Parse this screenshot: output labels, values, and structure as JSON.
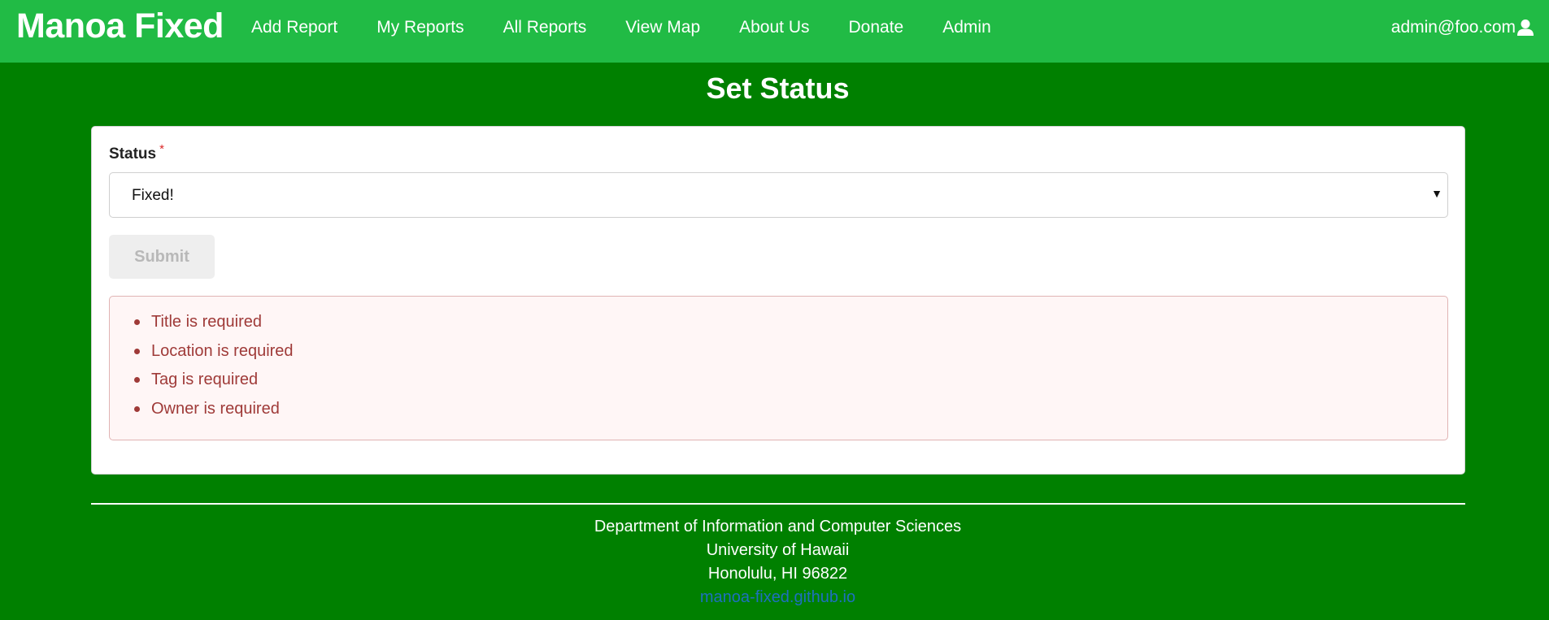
{
  "navbar": {
    "brand": "Manoa Fixed",
    "links": [
      "Add Report",
      "My Reports",
      "All Reports",
      "View Map",
      "About Us",
      "Donate",
      "Admin"
    ],
    "user_email": "admin@foo.com",
    "user_icon": "user-icon"
  },
  "page": {
    "title": "Set Status"
  },
  "form": {
    "status_label": "Status",
    "required_marker": "*",
    "status_value": "Fixed!",
    "dropdown_arrow": "▼",
    "submit_label": "Submit",
    "errors": [
      "Title is required",
      "Location is required",
      "Tag is required",
      "Owner is required"
    ]
  },
  "footer": {
    "line1": "Department of Information and Computer Sciences",
    "line2": "University of Hawaii",
    "line3": "Honolulu, HI 96822",
    "link": "manoa-fixed.github.io"
  },
  "colors": {
    "navbar_bg": "#21bb45",
    "page_bg": "#008000",
    "error_text": "#9f3a38",
    "error_bg": "#fff6f6",
    "link": "#1e70bf"
  }
}
